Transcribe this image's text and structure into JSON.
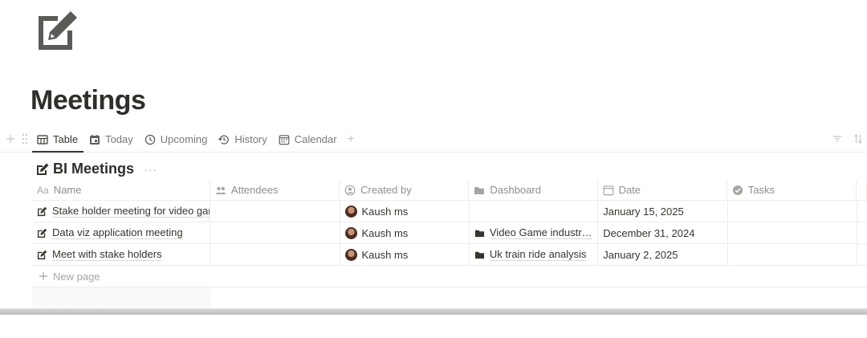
{
  "page": {
    "icon": "edit-square-icon",
    "title": "Meetings"
  },
  "views": {
    "tabs": [
      {
        "label": "Table",
        "icon": "table-icon",
        "active": true
      },
      {
        "label": "Today",
        "icon": "calendar-today-icon",
        "active": false
      },
      {
        "label": "Upcoming",
        "icon": "clock-icon",
        "active": false
      },
      {
        "label": "History",
        "icon": "history-icon",
        "active": false
      },
      {
        "label": "Calendar",
        "icon": "calendar-icon",
        "active": false
      }
    ],
    "add_view": "+"
  },
  "database": {
    "title": "BI Meetings",
    "more": "···",
    "columns": [
      {
        "label": "Name",
        "icon": "text-icon",
        "icon_text": "Aa"
      },
      {
        "label": "Attendees",
        "icon": "people-icon"
      },
      {
        "label": "Created by",
        "icon": "person-circle-icon"
      },
      {
        "label": "Dashboard",
        "icon": "folder-icon"
      },
      {
        "label": "Date",
        "icon": "calendar-icon"
      },
      {
        "label": "Tasks",
        "icon": "check-circle-icon"
      }
    ],
    "rows": [
      {
        "name": "Stake holder meeting for video game",
        "attendees": "",
        "created_by": "Kaush ms",
        "dashboard": "",
        "date": "January 15, 2025",
        "tasks": ""
      },
      {
        "name": "Data viz application meeting",
        "attendees": "",
        "created_by": "Kaush ms",
        "dashboard": "Video Game industry ...",
        "date": "December 31, 2024",
        "tasks": ""
      },
      {
        "name": "Meet with stake holders",
        "attendees": "",
        "created_by": "Kaush ms",
        "dashboard": "Uk train ride analysis",
        "date": "January 2, 2025",
        "tasks": ""
      }
    ],
    "new_page_label": "New page"
  },
  "colors": {
    "text": "#37352f",
    "muted": "#787774",
    "border": "#ececea",
    "icon": "#5f5e5b"
  }
}
